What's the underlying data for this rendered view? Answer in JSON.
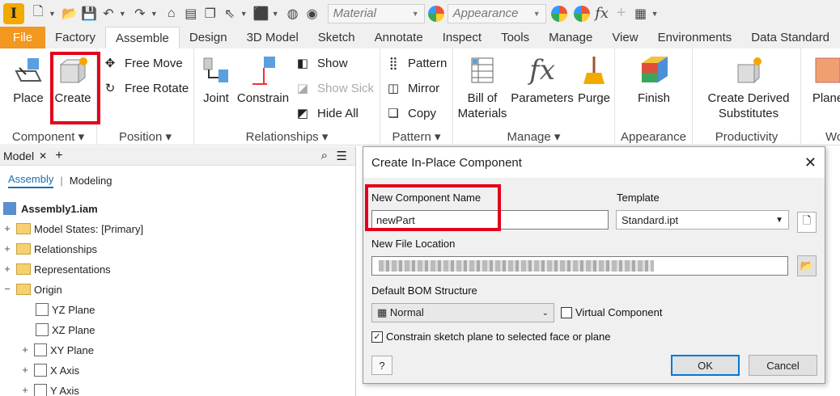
{
  "qat": {
    "material_placeholder": "Material",
    "appearance_placeholder": "Appearance",
    "fx": "fx"
  },
  "tabs": [
    "File",
    "Factory",
    "Assemble",
    "Design",
    "3D Model",
    "Sketch",
    "Annotate",
    "Inspect",
    "Tools",
    "Manage",
    "View",
    "Environments",
    "Data Standard"
  ],
  "ribbon": {
    "component": {
      "title": "Component",
      "place": "Place",
      "create": "Create"
    },
    "position": {
      "title": "Position",
      "free_move": "Free Move",
      "free_rotate": "Free Rotate"
    },
    "relationships": {
      "title": "Relationships",
      "joint": "Joint",
      "constrain": "Constrain",
      "show": "Show",
      "show_sick": "Show Sick",
      "hide_all": "Hide All"
    },
    "pattern": {
      "title": "Pattern",
      "pattern": "Pattern",
      "mirror": "Mirror",
      "copy": "Copy"
    },
    "manage": {
      "title": "Manage",
      "bom1": "Bill of",
      "bom2": "Materials",
      "parameters": "Parameters",
      "purge": "Purge"
    },
    "appearance": {
      "title": "Appearance",
      "finish": "Finish"
    },
    "productivity": {
      "title": "Productivity",
      "cds1": "Create Derived",
      "cds2": "Substitutes"
    },
    "work": {
      "title": "Wo",
      "plane": "Plane"
    }
  },
  "browser": {
    "tab": "Model",
    "close": "✕",
    "add": "+",
    "sub_assembly": "Assembly",
    "sub_modeling": "Modeling",
    "items": [
      "Assembly1.iam",
      "Model States: [Primary]",
      "Relationships",
      "Representations",
      "Origin",
      "YZ Plane",
      "XZ Plane",
      "XY Plane",
      "X Axis",
      "Y Axis"
    ]
  },
  "dialog": {
    "title": "Create In-Place Component",
    "name_label": "New Component Name",
    "name_value": "newPart",
    "template_label": "Template",
    "template_value": "Standard.ipt",
    "location_label": "New File Location",
    "bom_label": "Default BOM Structure",
    "bom_value": "Normal",
    "virtual": "Virtual Component",
    "constrain": "Constrain sketch plane to selected face or plane",
    "ok": "OK",
    "cancel": "Cancel",
    "help": "?"
  }
}
